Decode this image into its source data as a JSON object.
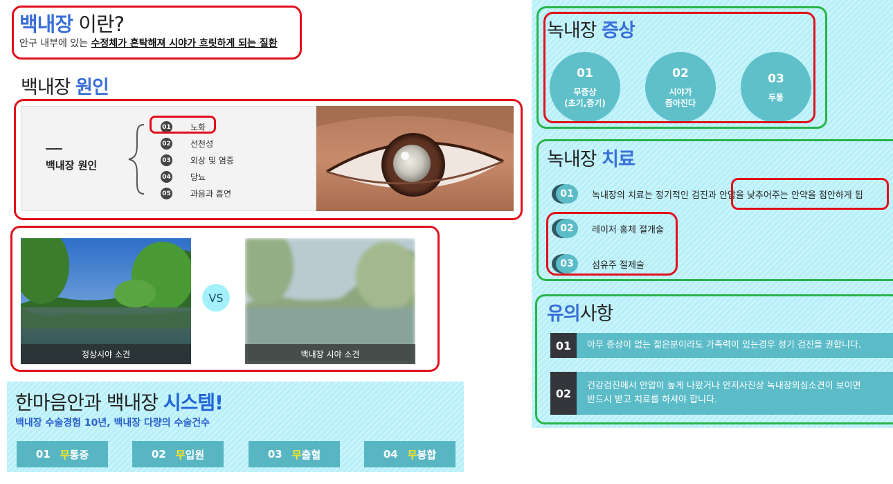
{
  "what_is": {
    "title_highlight": "백내장",
    "title_rest": " 이란?",
    "desc_prefix": "안구 내부에 있는 ",
    "desc_underlined": "수정체가 혼탁해져 시야가 흐릿하게 되는 질환"
  },
  "causes": {
    "title_plain": "백내장 ",
    "title_highlight": "원인",
    "label": "백내장 원인",
    "items": [
      {
        "num": "01",
        "label": "노화"
      },
      {
        "num": "02",
        "label": "선천성"
      },
      {
        "num": "03",
        "label": "외상 및 염증"
      },
      {
        "num": "04",
        "label": "당뇨"
      },
      {
        "num": "05",
        "label": "과음과 흡연"
      }
    ]
  },
  "comparison": {
    "normal_caption": "정상시야 소견",
    "vs": "VS",
    "cataract_caption": "백내장 시야 소견"
  },
  "system": {
    "title_plain": "한마음안과 백내장 ",
    "title_highlight": "시스템!",
    "subtitle": "백내장 수술경험 10년, 백내장 다량의 수술건수",
    "items": [
      {
        "num": "01",
        "mu": "무",
        "rest": "통증"
      },
      {
        "num": "02",
        "mu": "무",
        "rest": "입원"
      },
      {
        "num": "03",
        "mu": "무",
        "rest": "출혈"
      },
      {
        "num": "04",
        "mu": "무",
        "rest": "봉합"
      }
    ]
  },
  "symptoms": {
    "title_plain": "녹내장 ",
    "title_highlight": "증상",
    "items": [
      {
        "num": "01",
        "line1": "무증상",
        "line2": "(초기,중기)"
      },
      {
        "num": "02",
        "line1": "시야가",
        "line2": "좁아진다"
      },
      {
        "num": "03",
        "line1": "두통",
        "line2": ""
      }
    ]
  },
  "treatment": {
    "title_plain": "녹내장 ",
    "title_highlight": "치료",
    "items": [
      {
        "num": "01",
        "text": "녹내장의 치료는 정기적인 검진과 안압을 낮추어주는 안약을 점안하게 됩"
      },
      {
        "num": "02",
        "text": "레이저 홍체 절개술"
      },
      {
        "num": "03",
        "text": "섬유주 절제술"
      }
    ]
  },
  "cautions": {
    "title_highlight": "유의",
    "title_plain": "사항",
    "items": [
      {
        "num": "01",
        "line1": "아무 증상이 없는 젊은분이라도 가족력이 있는경우 정기 검진을 권합니다.",
        "line2": ""
      },
      {
        "num": "02",
        "line1": "건강검진에서 안압이 높게 나왔거나 안저사진상 녹내장의심소견이 보이면",
        "line2": "반드시 받고 치료를 하셔야 합니다."
      }
    ]
  },
  "colors": {
    "highlight_blue": "#3a6fd8",
    "panel_cyan": "#b8f0fa",
    "teal": "#5bbcc8",
    "annotation_red": "#e0101c",
    "annotation_green": "#28b44a",
    "mu_yellow": "#ffe71a"
  }
}
